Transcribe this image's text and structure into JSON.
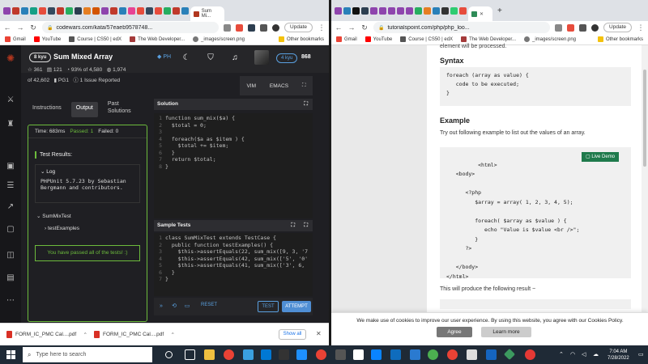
{
  "left_browser": {
    "active_tab_label": "Sum Mi...",
    "url": "codewars.com/kata/57eaeb9578748...",
    "update_label": "Update",
    "bookmarks": [
      "Gmail",
      "YouTube",
      "Course | CS50 | edX",
      "The Web Developer...",
      "_images/screen.png"
    ],
    "other_bookmarks": "Other bookmarks"
  },
  "codewars": {
    "kyu": "8 kyu",
    "title": "Sum Mixed Array",
    "meta": {
      "stars": "361",
      "votes": "121",
      "satisfaction": "93% of 4,580",
      "completions": "1,974"
    },
    "meta2": {
      "of": "of 42,602",
      "author": "PG1",
      "issue": "1 Issue Reported"
    },
    "user_kyu": "4 kyu",
    "honor": "868",
    "tabs": [
      "Instructions",
      "Output",
      "Past Solutions"
    ],
    "result": {
      "time": "Time: 683ms",
      "passed": "Passed: 1",
      "failed": "Failed: 0"
    },
    "test_results_label": "Test Results:",
    "log_label": "Log",
    "log_text": "PHPUnit 5.7.23 by Sebastian Bergmann and contributors.",
    "suite": "SumMixTest",
    "case": "testExamples",
    "passed_msg": "You have passed all of the tests! :)",
    "kbd": [
      "VIM",
      "EMACS"
    ],
    "solution_title": "Solution",
    "tests_title": "Sample Tests",
    "solution_code": [
      "function sum_mix($a) {",
      "  $total = 0;",
      "",
      "  foreach($a as $item ) {",
      "    $total += $item;",
      "  }",
      "  return $total;",
      "}"
    ],
    "test_code": [
      "class SumMixTest extends TestCase {",
      "  public function testExamples() {",
      "    $this->assertEquals(22, sum_mix([9, 3, '7",
      "    $this->assertEquals(42, sum_mix(['5', '0'",
      "    $this->assertEquals(41, sum_mix(['3', 6,",
      "  }",
      "}"
    ],
    "reset_label": "RESET",
    "test_label": "TEST",
    "attempt_label": "ATTEMPT"
  },
  "downloads": {
    "items": [
      "FORM_IC_PMC Cal....pdf",
      "FORM_IC_PMC Cal....pdf"
    ],
    "show_all": "Show all"
  },
  "right_browser": {
    "url": "tutorialspoint.com/php/php_loo...",
    "update_label": "Update",
    "bookmarks": [
      "Gmail",
      "YouTube",
      "Course | CS50 | edX",
      "The Web Developer...",
      "_images/screen.png"
    ],
    "other_bookmarks": "Other bookmarks"
  },
  "tutorial": {
    "fragment": "element will be processed.",
    "syntax_heading": "Syntax",
    "syntax_code": "foreach (array as value) {\n   code to be executed;\n}",
    "example_heading": "Example",
    "example_intro": "Try out following example to list out the values of an array.",
    "live_demo": "Live Demo",
    "example_code": "<html>\n   <body>\n\n      <?php\n         $array = array( 1, 2, 3, 4, 5);\n\n         foreach( $array as $value ) {\n            echo \"Value is $value <br />\";\n         }\n      ?>\n\n   </body>\n</html>",
    "result_intro": "This will produce the following result −",
    "cookie_text": "We make use of cookies to improve our user experience. By using this website, you agree with our Cookies Policy.",
    "agree": "Agree",
    "learn_more": "Learn more"
  },
  "taskbar": {
    "search_placeholder": "Type here to search",
    "time": "7:04 AM",
    "date": "7/28/2022"
  }
}
